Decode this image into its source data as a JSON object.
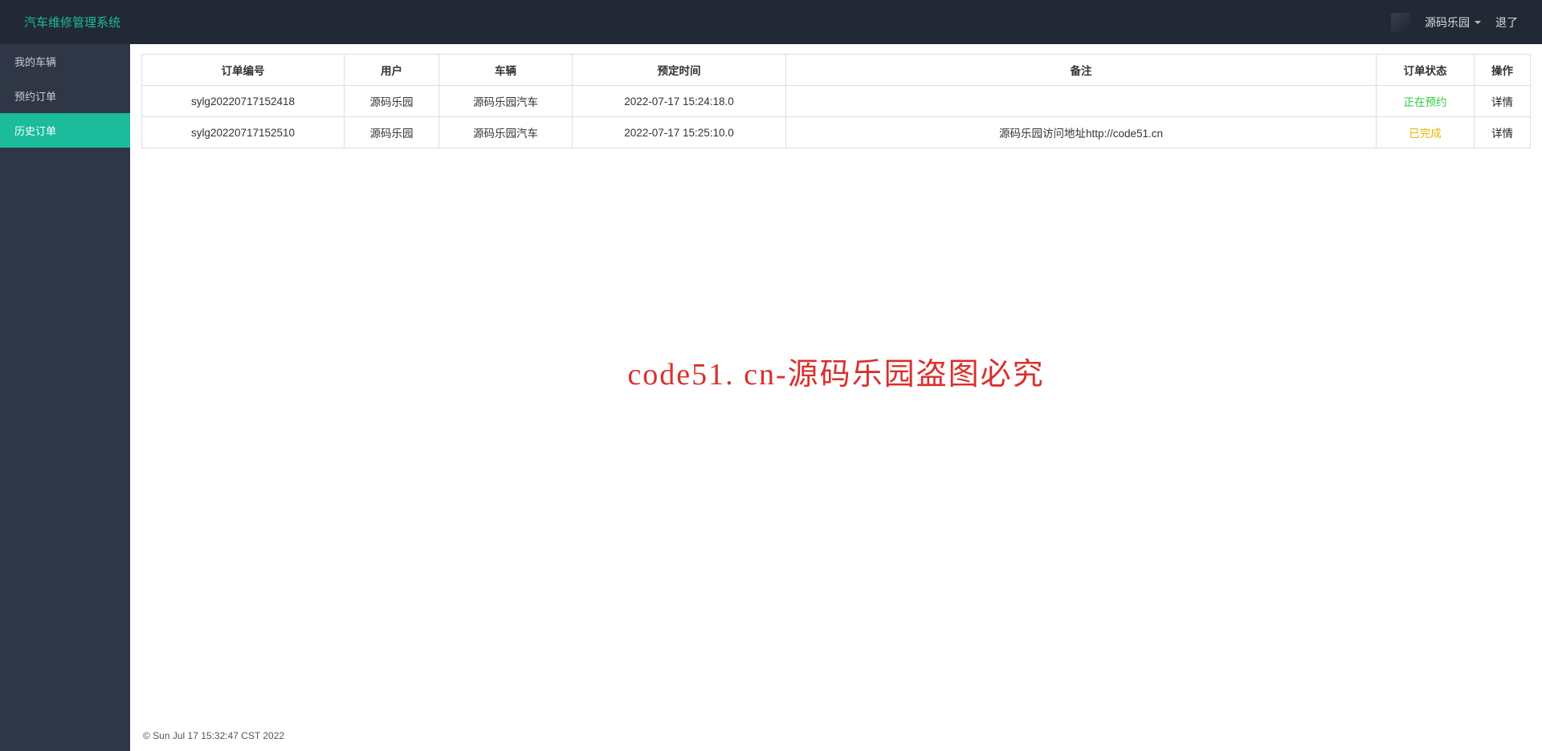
{
  "header": {
    "title": "汽车维修管理系统",
    "username": "源码乐园",
    "logout": "退了"
  },
  "sidebar": {
    "items": [
      {
        "label": "我的车辆"
      },
      {
        "label": "预约订单"
      },
      {
        "label": "历史订单"
      }
    ]
  },
  "table": {
    "headers": {
      "orderNo": "订单编号",
      "user": "用户",
      "vehicle": "车辆",
      "time": "预定时间",
      "remark": "备注",
      "status": "订单状态",
      "action": "操作"
    },
    "rows": [
      {
        "orderNo": "sylg20220717152418",
        "user": "源码乐园",
        "vehicle": "源码乐园汽车",
        "time": "2022-07-17 15:24:18.0",
        "remark": "",
        "status": "正在预约",
        "statusClass": "status-pending",
        "action": "详情"
      },
      {
        "orderNo": "sylg20220717152510",
        "user": "源码乐园",
        "vehicle": "源码乐园汽车",
        "time": "2022-07-17 15:25:10.0",
        "remark": "源码乐园访问地址http://code51.cn",
        "status": "已完成",
        "statusClass": "status-done",
        "action": "详情"
      }
    ]
  },
  "watermark": "code51. cn-源码乐园盗图必究",
  "footer": "© Sun Jul 17 15:32:47 CST 2022"
}
